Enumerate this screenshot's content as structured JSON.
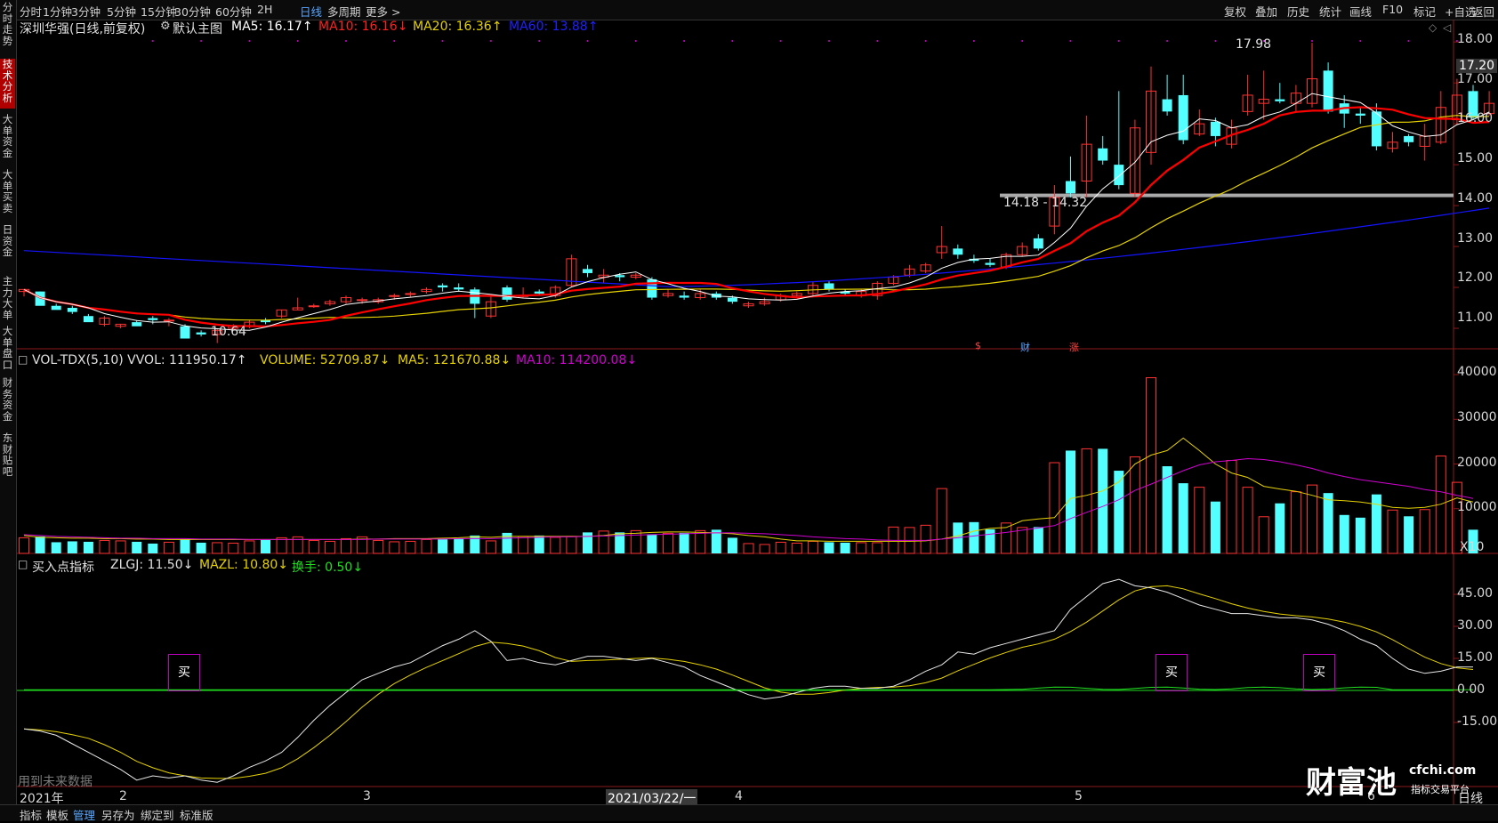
{
  "topbar": {
    "periods": [
      "分时",
      "1分钟",
      "3分钟",
      "5分钟",
      "15分钟",
      "30分钟",
      "60分钟",
      "2H",
      "日线",
      "多周期",
      "更多 >"
    ],
    "active_period": "日线",
    "right_items": [
      "复权",
      "叠加",
      "历史",
      "统计",
      "画线",
      "F10",
      "标记",
      "+自选",
      "返回"
    ]
  },
  "sidebar": {
    "tabs": [
      "分时走势",
      "技术分析",
      "大单资金",
      "大单买卖",
      "日资金",
      "主力大单",
      "大单盘口",
      "财务资金",
      "东财贴吧"
    ],
    "active": "技术分析"
  },
  "main_panel": {
    "stock_title": "深圳华强(日线,前复权)",
    "template": "默认主图",
    "ma5": "MA5: 16.17↑",
    "ma10": "MA10: 16.16↓",
    "ma20": "MA20: 16.36↑",
    "ma60": "MA60: 13.88↑",
    "high_label": "17.98",
    "low_label": "10.64",
    "range_label": "14.18 - 14.32",
    "current_price": "17.20",
    "events": [
      "$",
      "财",
      "涨"
    ],
    "axis": [
      "18.00",
      "17.00",
      "16.00",
      "15.00",
      "14.00",
      "13.00",
      "12.00",
      "11.00"
    ]
  },
  "volume_panel": {
    "title": "VOL-TDX(5,10) VVOL: 111950.17↑",
    "volume": "VOLUME: 52709.87↓",
    "ma5": "MA5: 121670.88↓",
    "ma10": "MA10: 114200.08↓",
    "axis": [
      "40000",
      "30000",
      "20000",
      "10000"
    ],
    "unit": "X10"
  },
  "indicator_panel": {
    "title": "买入点指标",
    "zlgj": "ZLGJ: 11.50↓",
    "mazl": "MAZL: 10.80↓",
    "huanshou": "换手: 0.50↓",
    "axis": [
      "45.00",
      "30.00",
      "15.00",
      "0.00",
      "-15.00"
    ],
    "buy_label": "买",
    "note": "用到未来数据"
  },
  "date_axis": {
    "labels": [
      "2021年",
      "2",
      "3",
      "2021/03/22/一",
      "4",
      "5",
      "6"
    ]
  },
  "watermark": {
    "brand": "财富池",
    "domain": "cfchi.com",
    "slogan": "指标交易平台"
  },
  "bottombar": {
    "items": [
      "指标",
      "模板",
      "管理",
      "另存为",
      "绑定到",
      "标准版"
    ],
    "active": "管理",
    "right": "日线"
  },
  "colors": {
    "up": "#ff3232",
    "down": "#54ffff",
    "ma5": "#ffffff",
    "ma10": "#ff0000",
    "ma20": "#e6d200",
    "ma60": "#1414ff",
    "purple": "#d000d0",
    "green": "#20e020"
  },
  "chart_data": {
    "type": "candlestick",
    "title": "深圳华强(日线,前复权)",
    "price_range": [
      10.5,
      18.2
    ],
    "candles": [
      [
        11.9,
        11.95,
        11.78,
        11.95
      ],
      [
        11.9,
        11.55,
        11.6,
        11.9
      ],
      [
        11.55,
        11.45,
        11.5,
        11.6
      ],
      [
        11.5,
        11.4,
        11.35,
        11.55
      ],
      [
        11.3,
        11.15,
        11.2,
        11.35
      ],
      [
        11.1,
        11.25,
        11.05,
        11.3
      ],
      [
        11.05,
        11.1,
        11.0,
        11.1
      ],
      [
        11.15,
        11.05,
        11.1,
        11.2
      ],
      [
        11.25,
        11.2,
        11.1,
        11.3
      ],
      [
        11.2,
        11.2,
        11.05,
        11.25
      ],
      [
        11.05,
        10.75,
        10.8,
        11.1
      ],
      [
        10.9,
        10.85,
        10.8,
        10.95
      ],
      [
        10.85,
        10.95,
        10.64,
        11.0
      ],
      [
        11.0,
        11.05,
        10.95,
        11.1
      ],
      [
        11.05,
        11.15,
        11.0,
        11.2
      ],
      [
        11.2,
        11.15,
        11.1,
        11.25
      ],
      [
        11.3,
        11.45,
        11.25,
        11.45
      ],
      [
        11.45,
        11.5,
        11.45,
        11.75
      ],
      [
        11.55,
        11.55,
        11.5,
        11.6
      ],
      [
        11.6,
        11.65,
        11.55,
        11.7
      ],
      [
        11.65,
        11.75,
        11.6,
        11.8
      ],
      [
        11.7,
        11.7,
        11.6,
        11.75
      ],
      [
        11.65,
        11.7,
        11.6,
        11.75
      ],
      [
        11.8,
        11.8,
        11.7,
        11.85
      ],
      [
        11.85,
        11.85,
        11.75,
        11.9
      ],
      [
        11.9,
        11.95,
        11.85,
        12.0
      ],
      [
        12.05,
        12.0,
        11.9,
        12.1
      ],
      [
        12.0,
        11.95,
        11.9,
        12.1
      ],
      [
        11.95,
        11.6,
        11.25,
        12.0
      ],
      [
        11.3,
        11.65,
        11.25,
        11.8
      ],
      [
        12.0,
        11.7,
        11.65,
        12.05
      ],
      [
        11.8,
        11.8,
        11.75,
        12.0
      ],
      [
        11.9,
        11.85,
        11.8,
        11.95
      ],
      [
        11.8,
        12.0,
        11.75,
        12.05
      ],
      [
        12.05,
        12.7,
        12.0,
        12.8
      ],
      [
        12.45,
        12.35,
        12.25,
        12.55
      ],
      [
        12.25,
        12.3,
        12.1,
        12.45
      ],
      [
        12.3,
        12.25,
        12.15,
        12.35
      ],
      [
        12.25,
        12.3,
        12.2,
        12.35
      ],
      [
        12.2,
        11.75,
        11.7,
        12.25
      ],
      [
        11.8,
        11.85,
        11.75,
        11.95
      ],
      [
        11.8,
        11.75,
        11.7,
        11.9
      ],
      [
        11.75,
        11.85,
        11.7,
        11.95
      ],
      [
        11.85,
        11.75,
        11.7,
        11.9
      ],
      [
        11.75,
        11.65,
        11.6,
        11.8
      ],
      [
        11.55,
        11.6,
        11.5,
        11.65
      ],
      [
        11.6,
        11.65,
        11.55,
        11.75
      ],
      [
        11.7,
        11.8,
        11.65,
        11.85
      ],
      [
        11.8,
        11.85,
        11.75,
        11.9
      ],
      [
        11.85,
        12.05,
        11.8,
        12.15
      ],
      [
        12.1,
        11.95,
        11.9,
        12.15
      ],
      [
        11.9,
        11.85,
        11.8,
        11.95
      ],
      [
        11.8,
        11.9,
        11.75,
        11.95
      ],
      [
        11.8,
        12.1,
        11.7,
        12.15
      ],
      [
        12.1,
        12.25,
        12.05,
        12.3
      ],
      [
        12.3,
        12.45,
        12.25,
        12.55
      ],
      [
        12.4,
        12.55,
        12.35,
        12.6
      ],
      [
        12.85,
        13.0,
        12.7,
        13.5
      ],
      [
        12.95,
        12.8,
        12.7,
        13.05
      ],
      [
        12.7,
        12.65,
        12.6,
        12.8
      ],
      [
        12.6,
        12.55,
        12.5,
        12.7
      ],
      [
        12.5,
        12.8,
        12.45,
        12.85
      ],
      [
        12.8,
        13.0,
        12.75,
        13.1
      ],
      [
        13.2,
        12.95,
        12.9,
        13.3
      ],
      [
        13.5,
        14.2,
        13.3,
        14.5
      ],
      [
        14.6,
        14.3,
        14.2,
        15.2
      ],
      [
        14.6,
        15.5,
        14.2,
        16.2
      ],
      [
        15.4,
        15.1,
        15.0,
        15.7
      ],
      [
        15.0,
        14.5,
        14.4,
        16.8
      ],
      [
        14.3,
        15.9,
        14.2,
        16.1
      ],
      [
        15.3,
        16.8,
        15.0,
        17.4
      ],
      [
        16.6,
        16.3,
        16.2,
        17.2
      ],
      [
        16.7,
        15.6,
        15.5,
        17.2
      ],
      [
        15.75,
        16.0,
        15.7,
        16.35
      ],
      [
        16.05,
        15.7,
        15.45,
        16.15
      ],
      [
        15.5,
        15.9,
        15.4,
        16.1
      ],
      [
        16.3,
        16.7,
        16.2,
        17.2
      ],
      [
        16.5,
        16.6,
        16.1,
        17.3
      ],
      [
        16.6,
        16.55,
        16.5,
        17.0
      ],
      [
        16.5,
        16.75,
        16.3,
        16.95
      ],
      [
        16.5,
        17.1,
        16.4,
        17.98
      ],
      [
        17.3,
        16.3,
        16.25,
        17.5
      ],
      [
        16.5,
        16.25,
        15.9,
        16.7
      ],
      [
        16.25,
        16.2,
        16.0,
        16.4
      ],
      [
        16.3,
        15.45,
        15.35,
        16.5
      ],
      [
        15.4,
        15.55,
        15.3,
        15.8
      ],
      [
        15.7,
        15.55,
        15.45,
        15.75
      ],
      [
        15.45,
        15.7,
        15.1,
        16.0
      ],
      [
        15.55,
        16.4,
        15.5,
        16.8
      ],
      [
        16.1,
        16.7,
        16.0,
        17.1
      ],
      [
        16.8,
        16.15,
        16.1,
        16.95
      ],
      [
        16.25,
        16.5,
        16.2,
        16.8
      ]
    ],
    "volume_range": [
      0,
      41000
    ],
    "volumes": [
      3500,
      3800,
      2500,
      2700,
      2600,
      2900,
      2800,
      2600,
      2200,
      2500,
      3100,
      2400,
      2400,
      2300,
      2800,
      3100,
      3500,
      3700,
      2900,
      2700,
      3300,
      3700,
      2900,
      2600,
      2700,
      3100,
      3300,
      3400,
      4000,
      2800,
      4600,
      3800,
      4000,
      3600,
      3800,
      4700,
      5000,
      4700,
      5100,
      4300,
      4500,
      4600,
      5100,
      5300,
      3500,
      2200,
      2000,
      2500,
      2300,
      2700,
      2500,
      2400,
      2400,
      2400,
      5900,
      5800,
      6300,
      14500,
      6900,
      7000,
      5400,
      6800,
      5800,
      5900,
      20300,
      23000,
      23400,
      23400,
      18500,
      21600,
      39300,
      19500,
      15700,
      14800,
      11600,
      20800,
      14800,
      8200,
      11200,
      13800,
      15300,
      13500,
      8600,
      8000,
      13200,
      9700,
      8300,
      9800,
      21800,
      15900,
      5300
    ],
    "volume_ma5_series": [
      4000,
      3600,
      3500,
      3400,
      3400,
      3300,
      3300,
      3200,
      3200,
      3100,
      3100,
      3100,
      3100,
      3100,
      3100,
      3100,
      3100,
      3100,
      3100,
      3100,
      3100,
      3200,
      3200,
      3300,
      3300,
      3300,
      3400,
      3500,
      3700,
      3600,
      3800,
      3800,
      3800,
      3800,
      3800,
      3800,
      4000,
      4400,
      4500,
      4700,
      4800,
      4800,
      4700,
      4600,
      4400,
      4000,
      3700,
      3200,
      2800,
      2800,
      2700,
      2700,
      2700,
      2700,
      2700,
      2700,
      2800,
      3200,
      3900,
      5000,
      5600,
      5800,
      7300,
      7700,
      8000,
      12300,
      13000,
      14000,
      16000,
      20000,
      22000,
      23000,
      25800,
      23000,
      20000,
      18000,
      17000,
      15000,
      14400,
      13900,
      13000,
      12000,
      11800,
      11500,
      11000,
      10300,
      10100,
      10300,
      11000,
      12400,
      11500
    ],
    "volume_ma10_series": [
      4200,
      4000,
      3800,
      3700,
      3600,
      3500,
      3400,
      3400,
      3300,
      3300,
      3300,
      3200,
      3200,
      3200,
      3100,
      3100,
      3100,
      3100,
      3100,
      3100,
      3100,
      3100,
      3200,
      3200,
      3200,
      3200,
      3200,
      3300,
      3300,
      3300,
      3400,
      3500,
      3600,
      3700,
      3700,
      3800,
      3900,
      4000,
      4100,
      4200,
      4300,
      4400,
      4500,
      4600,
      4600,
      4500,
      4400,
      4200,
      4000,
      3700,
      3500,
      3300,
      3200,
      3000,
      2900,
      2900,
      2900,
      3200,
      3500,
      3900,
      4300,
      4700,
      5200,
      5700,
      6200,
      7800,
      9200,
      10500,
      12000,
      14100,
      15500,
      17000,
      18500,
      19800,
      20500,
      20800,
      21200,
      21000,
      20500,
      19800,
      19000,
      18000,
      17200,
      16500,
      16000,
      15500,
      15000,
      14300,
      13800,
      13000,
      12300
    ]
  }
}
